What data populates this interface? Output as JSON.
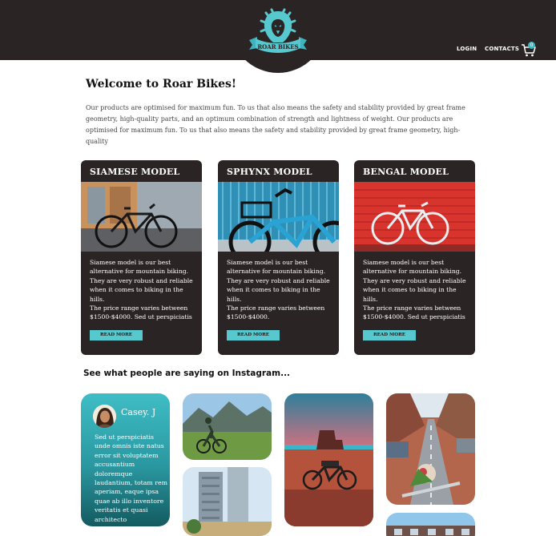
{
  "brand": {
    "name": "ROAR BIKES",
    "accent": "#58c8cf",
    "dark": "#2a2425"
  },
  "nav": {
    "login": "LOGIN",
    "contacts": "CONTACTS",
    "cart_count": "0"
  },
  "welcome": {
    "title": "Welcome to Roar Bikes!",
    "text": "Our products are optimised for maximum fun. To us that also means the safety and stability provided by great frame geometry, high-quality parts, and an optimum combination of strength and lightness of weight. Our products are optimised for maximum fun. To us that also means the safety and stability provided by great frame geometry, high-quality"
  },
  "cards": [
    {
      "title": "SIAMESE MODEL",
      "text": "Siamese model is our best alternative for mountain biking. They are very robust and reliable when it comes to biking in the hills.\nThe price range varies between $1500-$4000.  Sed ut perspiciatis",
      "button": "READ MORE"
    },
    {
      "title": "SPHYNX MODEL",
      "text": "Siamese model is our best alternative for mountain biking. They are very robust and reliable when it comes to biking in the hills.\nThe price range varies between $1500-$4000.",
      "button": "READ MORE"
    },
    {
      "title": "BENGAL MODEL",
      "text": "Siamese model is our best alternative for mountain biking. They are very robust and reliable when it comes to biking in the hills.\nThe price range varies between $1500-$4000.  Sed ut perspiciatis",
      "button": "READ MORE"
    }
  ],
  "instagram": {
    "title": "See what people are saying on Instagram...",
    "testimonial": {
      "name": "Casey. J",
      "text": "Sed ut perspiciatis unde omnis iste natus error sit voluptatem accusantium doloremque laudantium, totam rem aperiam, eaque ipsa quae ab illo inventore veritatis et quasi architecto"
    }
  }
}
